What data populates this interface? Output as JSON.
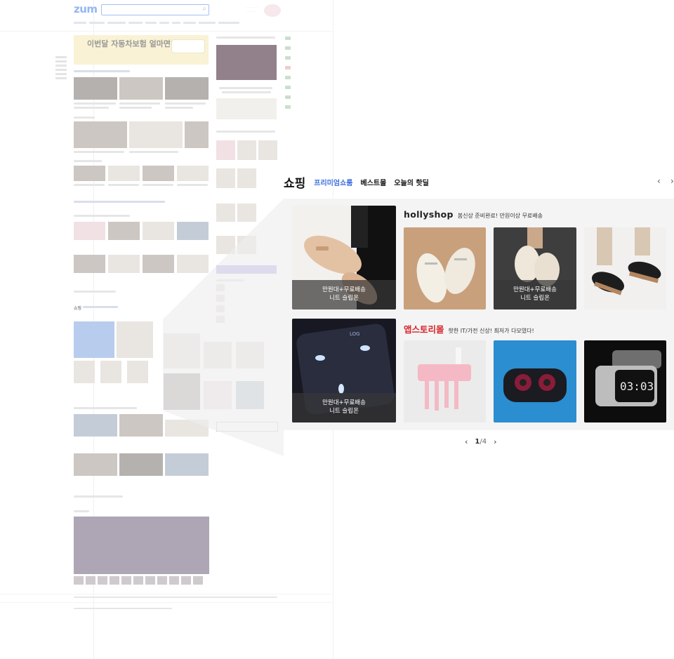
{
  "shopping": {
    "title": "쇼핑",
    "tabs": [
      "프리미엄쇼룸",
      "베스트몰",
      "오늘의 핫딜"
    ],
    "prev_glyph": "‹",
    "next_glyph": "›",
    "featured": [
      {
        "overlay_line1": "만원대+무료배송",
        "overlay_line2": "니트 슬립온"
      },
      {
        "overlay_line1": "만원대+무료배송",
        "overlay_line2": "니트 슬립온"
      }
    ],
    "rows": [
      {
        "brand": "hollyshop",
        "desc": "봄신상 준비완료! 만원이상 무료배송",
        "items": [
          {
            "overlay_line1": "",
            "overlay_line2": ""
          },
          {
            "overlay_line1": "만원대+무료배송",
            "overlay_line2": "니트 슬립온"
          },
          {
            "overlay_line1": "",
            "overlay_line2": ""
          }
        ]
      },
      {
        "brand": "앱스토리몰",
        "desc": "핫한 IT/가전 신상! 최저가 다모였다!",
        "items": [
          {
            "overlay_line1": "",
            "overlay_line2": ""
          },
          {
            "overlay_line1": "",
            "overlay_line2": ""
          },
          {
            "overlay_line1": "",
            "overlay_line2": "",
            "clock_text": "03:03"
          }
        ]
      }
    ],
    "pager": {
      "current": "1",
      "total": "/4"
    }
  },
  "background_page": {
    "logo": "zum",
    "banner_text": "이번달 자동차보험 얼마면?"
  },
  "colors": {
    "accent_blue": "#3d6fe0",
    "brand_red": "#d8232a",
    "panel_bg": "#f4f4f4",
    "overlay": "rgba(55,55,55,0.72)"
  }
}
